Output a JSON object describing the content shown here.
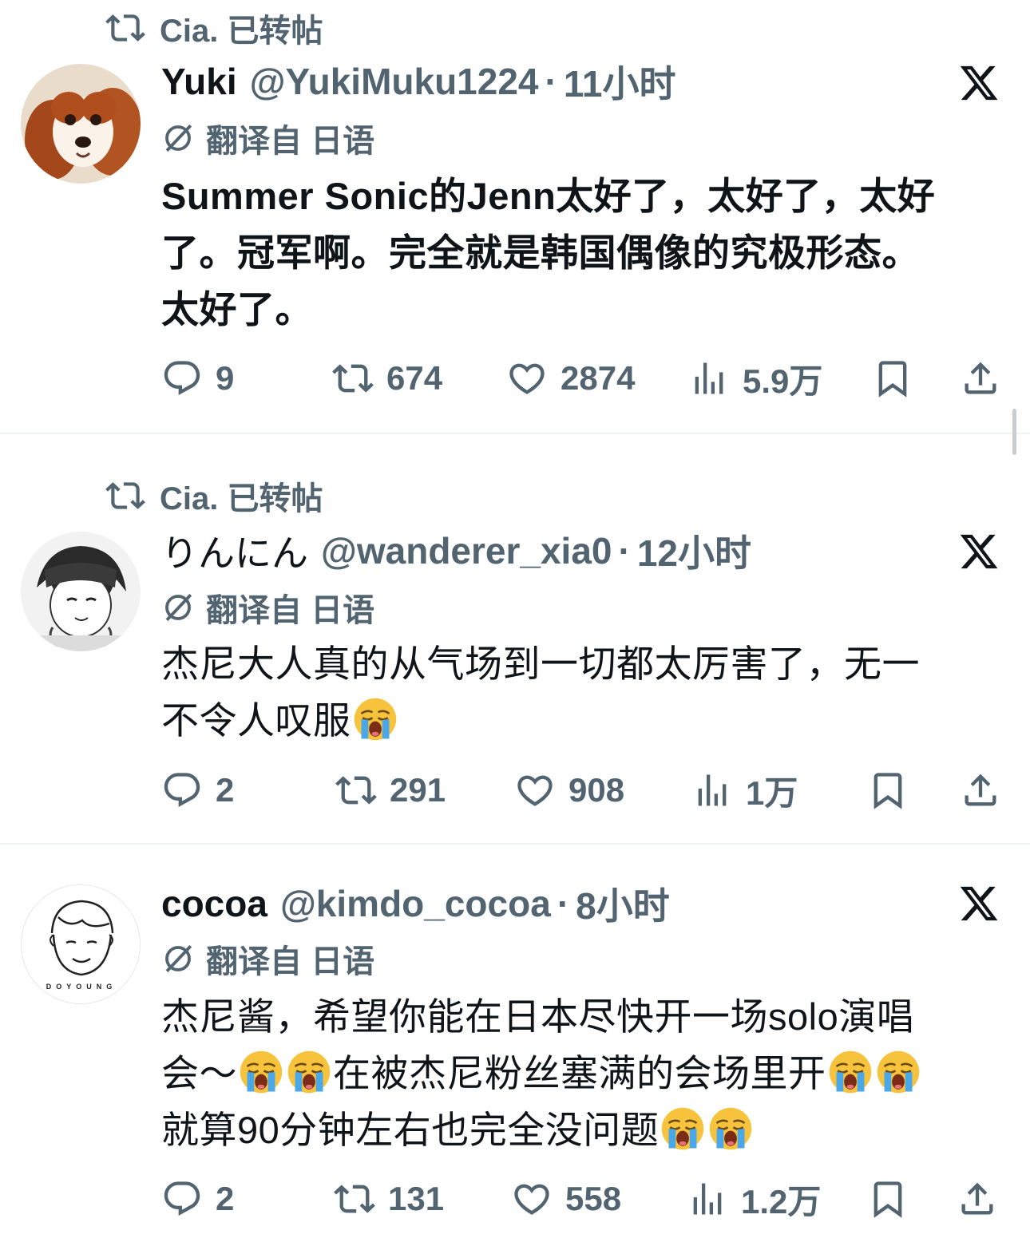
{
  "colors": {
    "text_primary": "#0f1419",
    "text_secondary": "#536471",
    "divider": "#eff3f4"
  },
  "icons": {
    "retweet": "retweet-icon",
    "translate": "translate-icon",
    "x_logo": "x-logo-icon",
    "reply": "reply-icon",
    "like": "heart-icon",
    "views": "views-icon",
    "bookmark": "bookmark-icon",
    "share": "share-icon",
    "emoji": "loudly-crying-face-emoji"
  },
  "tweets": [
    {
      "retweeted_by": "Cia. 已转帖",
      "display_name": "Yuki",
      "handle": "@YukiMuku1224",
      "time": "11小时",
      "translate": "翻译自 日语",
      "lines": [
        "Summer Sonic的Jenn太好了，太好了，太好",
        "了。冠军啊。完全就是韩国偶像的究极形态。",
        "太好了。"
      ],
      "replies": "9",
      "reposts": "674",
      "likes": "2874",
      "views": "5.9万"
    },
    {
      "retweeted_by": "Cia. 已转帖",
      "display_name": "りんにん",
      "handle": "@wanderer_xia0",
      "time": "12小时",
      "translate": "翻译自 日语",
      "lines": [
        "杰尼大人真的从气场到一切都太厉害了，无一",
        "不令人叹服"
      ],
      "replies": "2",
      "reposts": "291",
      "likes": "908",
      "views": "1万"
    },
    {
      "display_name": "cocoa",
      "handle": "@kimdo_cocoa",
      "time": "8小时",
      "translate": "翻译自 日语",
      "lines": [
        "杰尼酱，希望你能在日本尽快开一场solo演唱",
        "会～",
        "在被杰尼粉丝塞满的会场里开",
        "就算90分钟左右也完全没问题"
      ],
      "avatar_text": "DOYOUNG",
      "replies": "2",
      "reposts": "131",
      "likes": "558",
      "views": "1.2万"
    }
  ]
}
